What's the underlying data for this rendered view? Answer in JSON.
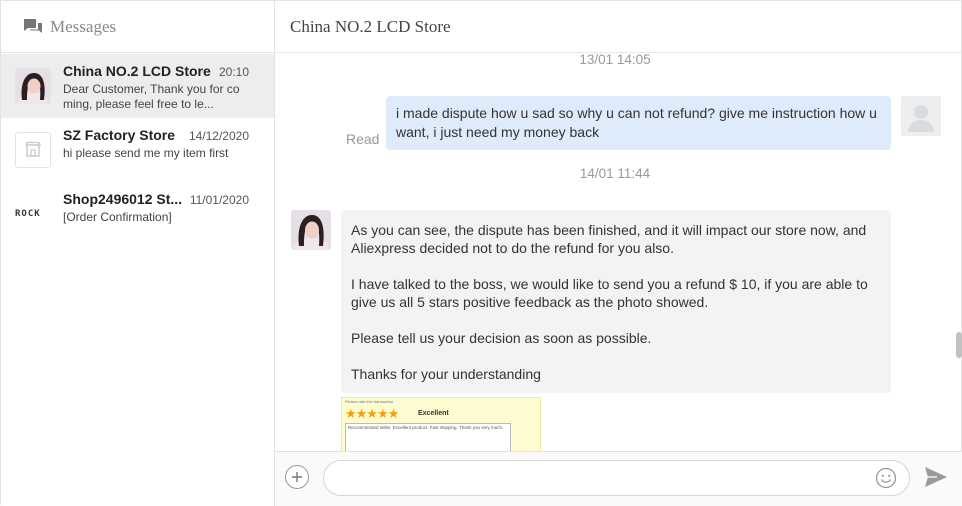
{
  "sidebar": {
    "title": "Messages",
    "conversations": [
      {
        "name": "China NO.2 LCD Store",
        "time": "20:10",
        "preview": "Dear Customer, Thank you for co ming, please feel free to le...",
        "active": true,
        "avatar_icon": "store-avatar-photo"
      },
      {
        "name": "SZ Factory Store",
        "time": "14/12/2020",
        "preview": "hi please send me my item first",
        "active": false,
        "avatar_icon": "shop-placeholder-icon"
      },
      {
        "name": "Shop2496012 St...",
        "time": "11/01/2020",
        "preview": "[Order Confirmation]",
        "active": false,
        "avatar_icon": "rock-logo",
        "logo_text": "ROCK"
      }
    ]
  },
  "chat": {
    "store_name": "China NO.2 LCD Store",
    "messages": [
      {
        "type": "timestamp",
        "text": "13/01 14:05"
      },
      {
        "type": "outgoing",
        "text": "i made dispute how u sad so why u can not refund? give me instruction how u want, i just need my money back",
        "status": "Read"
      },
      {
        "type": "timestamp",
        "text": "14/01 11:44"
      },
      {
        "type": "incoming",
        "paragraphs": [
          "As you can see, the dispute has been finished, and it will impact our store now, and Aliexpress decided not to do the refund for you also.",
          "I have talked to the boss, we would like to send you a refund $ 10, if you are able to give us all 5 stars positive feedback as the photo showed.",
          "Please tell us your decision as soon as possible.",
          "Thanks for your understanding"
        ]
      },
      {
        "type": "image",
        "rate_label": "Please rate this transaction",
        "stars": "★★★★★",
        "rating_text": "Excellent",
        "review_text": "Recommended seller. Excellent product. Fast shipping. Thank you very much."
      }
    ]
  },
  "input": {
    "placeholder": "",
    "add_icon": "plus-icon",
    "emoji_icon": "smiley-icon",
    "send_icon": "send-icon"
  },
  "colors": {
    "outgoing_bubble": "#deebfa",
    "incoming_bubble": "#f3f3f3",
    "active_conversation": "#ededed",
    "star": "#f3a200"
  }
}
